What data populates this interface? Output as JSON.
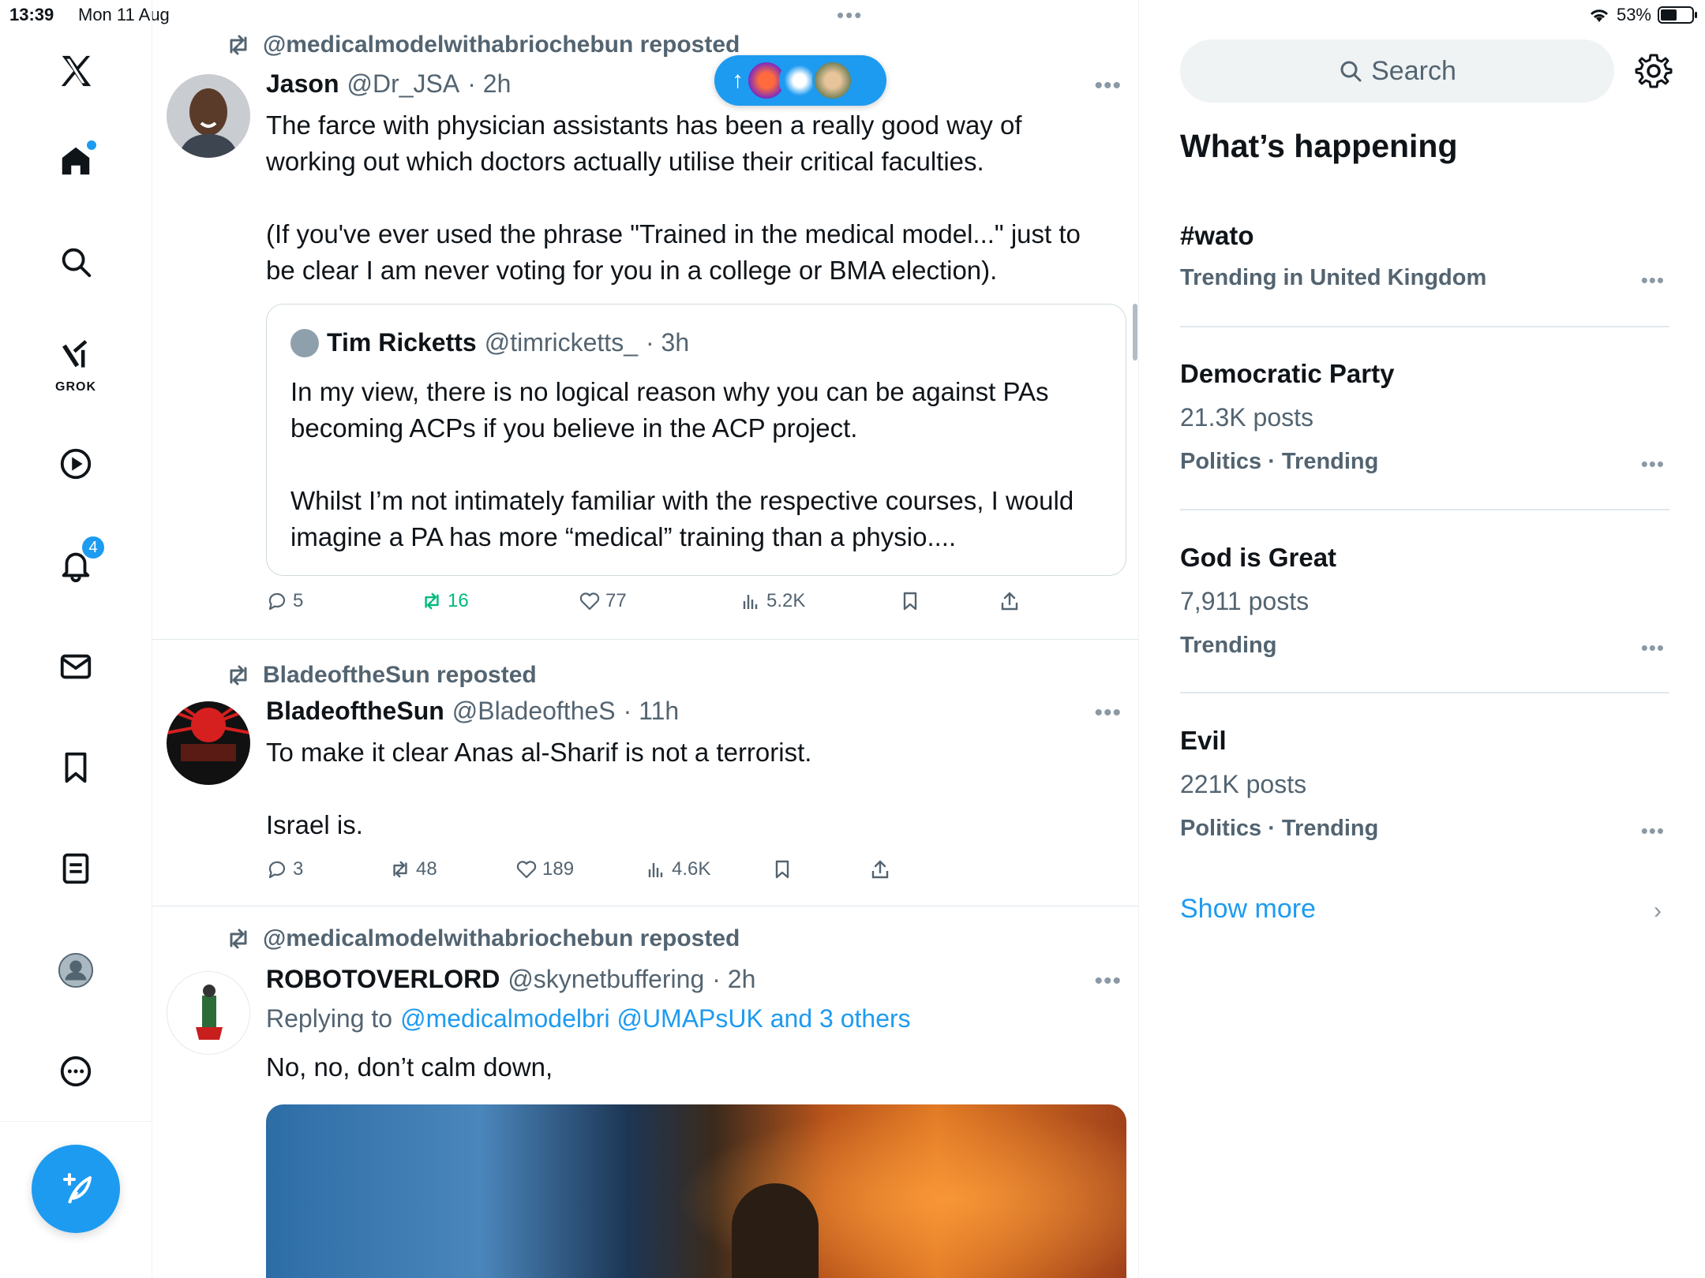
{
  "status_bar": {
    "time": "13:39",
    "date": "Mon 11 Aug",
    "battery_text": "53%",
    "battery_level": 0.53
  },
  "nav": {
    "grok_label": "GROK",
    "notification_count": "4"
  },
  "new_posts_pill": {
    "arrow": "↑"
  },
  "tweets": [
    {
      "repost_by": "@medicalmodelwithabriochebun reposted",
      "name": "Jason",
      "handle": "@Dr_JSA",
      "time": "· 2h",
      "paragraphs": [
        "The farce with physician assistants has been a really good way of working out which doctors actually utilise their critical faculties.",
        "(If you've ever used the phrase \"Trained in the medical model...\" just to be clear I am never voting for you in a college or BMA election)."
      ],
      "quote": {
        "name": "Tim Ricketts",
        "handle": "@timricketts_",
        "time": "· 3h",
        "paragraphs": [
          "In my view, there is no logical reason why you can be against PAs becoming ACPs if you believe in the ACP project.",
          "Whilst I’m not intimately familiar with the respective courses, I would imagine a PA has more “medical” training than a physio...."
        ]
      },
      "replies": "5",
      "reposts": "16",
      "likes": "77",
      "views": "5.2K"
    },
    {
      "repost_by": "BladeoftheSun reposted",
      "name": "BladeoftheSun",
      "handle": "@BladeoftheS",
      "time": "· 11h",
      "paragraphs": [
        "To make it clear Anas al-Sharif is not a terrorist.",
        "Israel is."
      ],
      "replies": "3",
      "reposts": "48",
      "likes": "189",
      "views": "4.6K"
    },
    {
      "repost_by": "@medicalmodelwithabriochebun reposted",
      "name": "ROBOTOVERLORD",
      "handle": "@skynetbuffering",
      "time": "· 2h",
      "replying_prefix": "Replying to",
      "replying_to": "@medicalmodelbri @UMAPsUK and 3 others",
      "paragraphs": [
        "No, no, don’t calm down,"
      ]
    }
  ],
  "sidebar": {
    "search_placeholder": "Search",
    "title": "What’s happening",
    "trends": [
      {
        "name": "#wato",
        "posts": "",
        "meta": "Trending in United Kingdom"
      },
      {
        "name": "Democratic Party",
        "posts": "21.3K posts",
        "meta": "Politics · Trending"
      },
      {
        "name": "God is Great",
        "posts": "7,911 posts",
        "meta": "Trending"
      },
      {
        "name": "Evil",
        "posts": "221K posts",
        "meta": "Politics · Trending"
      }
    ],
    "show_more": "Show more"
  },
  "colors": {
    "accent": "#1d9bf0",
    "text": "#0f1419",
    "muted": "#536471",
    "repost_green": "#00ba7c"
  },
  "icons": [
    "x-logo-icon",
    "home-icon",
    "search-icon",
    "grok-icon",
    "video-icon",
    "bell-icon",
    "mail-icon",
    "bookmark-icon",
    "list-icon",
    "profile-icon",
    "more-icon",
    "compose-icon",
    "repost-icon",
    "reply-icon",
    "like-icon",
    "views-icon",
    "share-icon",
    "gear-icon",
    "chevron-right-icon"
  ]
}
